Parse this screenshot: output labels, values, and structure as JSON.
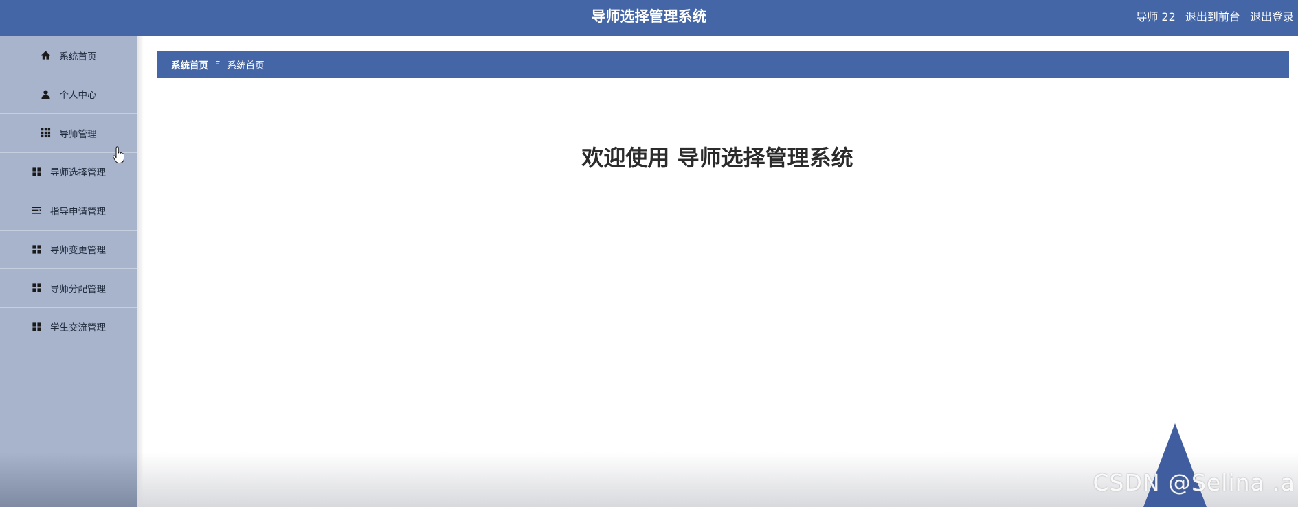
{
  "header": {
    "title": "导师选择管理系统",
    "user_label": "导师 22",
    "back_to_front": "退出到前台",
    "logout": "退出登录"
  },
  "sidebar": {
    "items": [
      {
        "label": "系统首页",
        "icon": "home-icon"
      },
      {
        "label": "个人中心",
        "icon": "user-icon"
      },
      {
        "label": "导师管理",
        "icon": "grid-icon"
      },
      {
        "label": "导师选择管理",
        "icon": "apps-icon"
      },
      {
        "label": "指导申请管理",
        "icon": "list-icon"
      },
      {
        "label": "导师变更管理",
        "icon": "apps-icon"
      },
      {
        "label": "导师分配管理",
        "icon": "apps-icon"
      },
      {
        "label": "学生交流管理",
        "icon": "apps-icon"
      }
    ]
  },
  "breadcrumb": {
    "home": "系统首页",
    "separator": "Ξ",
    "current": "系统首页"
  },
  "main": {
    "welcome": "欢迎使用 导师选择管理系统"
  },
  "watermark": "CSDN @Selina .a",
  "colors": {
    "header_bg": "#4466a6",
    "sidebar_bg": "#a7b4cc",
    "breadcrumb_bg": "#4466a6"
  }
}
